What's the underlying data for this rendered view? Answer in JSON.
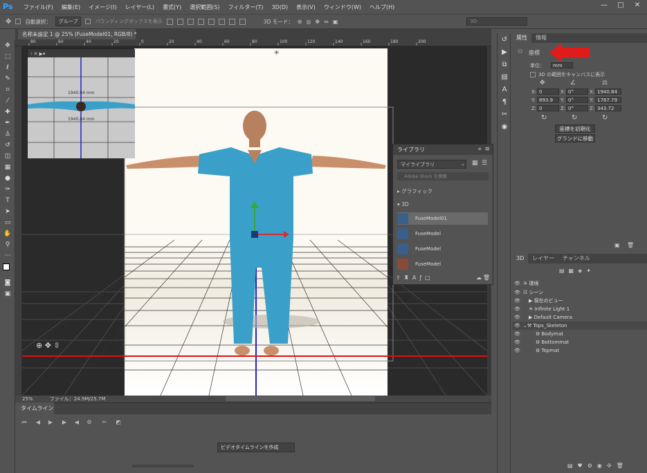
{
  "app": {
    "logo": "Ps"
  },
  "menu": [
    "ファイル(F)",
    "編集(E)",
    "イメージ(I)",
    "レイヤー(L)",
    "書式(Y)",
    "選択範囲(S)",
    "フィルター(T)",
    "3D(D)",
    "表示(V)",
    "ウィンドウ(W)",
    "ヘルプ(H)"
  ],
  "options": {
    "auto_select": "自動選択：",
    "group": "グループ",
    "bbox": "バウンディングボックスを表示",
    "mode3d": "3D モード：",
    "workspace": "3D"
  },
  "doc_tab": "名称未設定 1 @ 25% (FuseModel01, RGB/8) *",
  "status": {
    "zoom": "25%",
    "file": "ファイル：24.9M/25.7M"
  },
  "thumb": {
    "label_top": "1940.84 mm",
    "label_bottom": "1940.84 mm"
  },
  "library": {
    "title": "ライブラリ",
    "dropdown": "マイライブラリ",
    "search": "Adobe Stock を検索",
    "graphics": "グラフィック",
    "section3d": "3D",
    "items": [
      "FuseModel01",
      "FuseModel",
      "FuseModel",
      "FuseModel"
    ]
  },
  "timeline": {
    "tab": "タイムライン",
    "create_btn": "ビデオタイムラインを作成"
  },
  "properties": {
    "tabs": [
      "属性",
      "情報"
    ],
    "section": "座標",
    "unit_label": "単位：",
    "unit_value": "mm",
    "check_label": "3D の範囲をキャンバスに表示",
    "pos": {
      "x": "0",
      "y": "893.9",
      "z": "0"
    },
    "rot": {
      "x": "0°",
      "y": "0°",
      "z": "0°"
    },
    "scale": {
      "x": "1940.84",
      "y": "1787.79",
      "z": "343.72"
    },
    "btn_reset": "座標を初期化",
    "btn_ground": "グランドに移動"
  },
  "layers3d": {
    "tabs": [
      "3D",
      "レイヤー",
      "チャンネル"
    ],
    "rows": [
      "環境",
      "シーン",
      "現在のビュー",
      "Infinite Light 1",
      "Default Camera",
      "Tops_Skeleton",
      "Bodymat",
      "Bottommat",
      "Topmat"
    ]
  },
  "rulers": {
    "top": [
      "80",
      "60",
      "40",
      "20",
      "0",
      "20",
      "40",
      "60",
      "80",
      "100",
      "120",
      "140",
      "160",
      "180",
      "200"
    ]
  },
  "colors": {
    "accent": "#31a8ff",
    "shirt": "#3a9fc9",
    "arrow": "#e11b1b"
  }
}
